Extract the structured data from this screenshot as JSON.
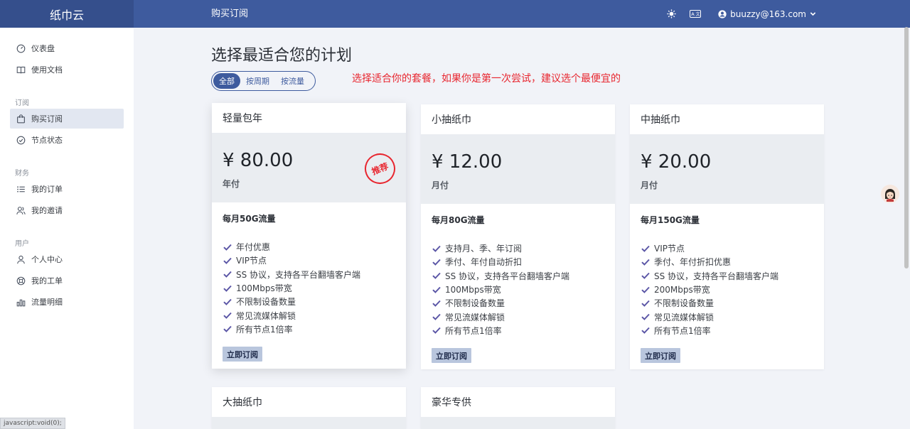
{
  "app": {
    "brand": "纸巾云",
    "page_heading": "购买订阅"
  },
  "header": {
    "user_email": "buuzzy@163.com"
  },
  "sidebar": {
    "items_top": [
      {
        "label": "仪表盘",
        "icon": "dashboard-icon"
      },
      {
        "label": "使用文档",
        "icon": "book-icon"
      }
    ],
    "groups": [
      {
        "title": "订阅",
        "items": [
          {
            "label": "购买订阅",
            "icon": "bag-icon"
          },
          {
            "label": "节点状态",
            "icon": "check-circle-icon"
          }
        ]
      },
      {
        "title": "财务",
        "items": [
          {
            "label": "我的订单",
            "icon": "list-icon"
          },
          {
            "label": "我的邀请",
            "icon": "users-icon"
          }
        ]
      },
      {
        "title": "用户",
        "items": [
          {
            "label": "个人中心",
            "icon": "user-icon"
          },
          {
            "label": "我的工单",
            "icon": "support-icon"
          },
          {
            "label": "流量明细",
            "icon": "bar-chart-icon"
          }
        ]
      }
    ]
  },
  "main": {
    "title": "选择最适合您的计划",
    "filters": [
      "全部",
      "按周期",
      "按流量"
    ],
    "hint": "选择适合你的套餐，如果你是第一次尝试，建议选个最便宜的",
    "subscribe_label": "立即订阅",
    "recommend_label": "推荐",
    "plans": [
      {
        "name": "轻量包年",
        "price": "¥ 80.00",
        "period": "年付",
        "traffic": "每月50G流量",
        "features": [
          "年付优惠",
          "VIP节点",
          "SS 协议，支持各平台翻墙客户端",
          "100Mbps带宽",
          "不限制设备数量",
          "常见流媒体解锁",
          "所有节点1倍率"
        ]
      },
      {
        "name": "小抽纸巾",
        "price": "¥ 12.00",
        "period": "月付",
        "traffic": "每月80G流量",
        "features": [
          "支持月、季、年订阅",
          "季付、年付自动折扣",
          "SS 协议，支持各平台翻墙客户端",
          "100Mbps带宽",
          "不限制设备数量",
          "常见流媒体解锁",
          "所有节点1倍率"
        ]
      },
      {
        "name": "中抽纸巾",
        "price": "¥ 20.00",
        "period": "月付",
        "traffic": "每月150G流量",
        "features": [
          "VIP节点",
          "季付、年付折扣优惠",
          "SS 协议，支持各平台翻墙客户端",
          "200Mbps带宽",
          "不限制设备数量",
          "常见流媒体解锁",
          "所有节点1倍率"
        ]
      },
      {
        "name": "大抽纸巾"
      },
      {
        "name": "豪华专供"
      }
    ]
  },
  "status_bar": {
    "text": "javascript:void(0);"
  },
  "colors": {
    "primary": "#3e5b9e",
    "accent_red": "#e8262f",
    "check": "#5b56a6"
  }
}
